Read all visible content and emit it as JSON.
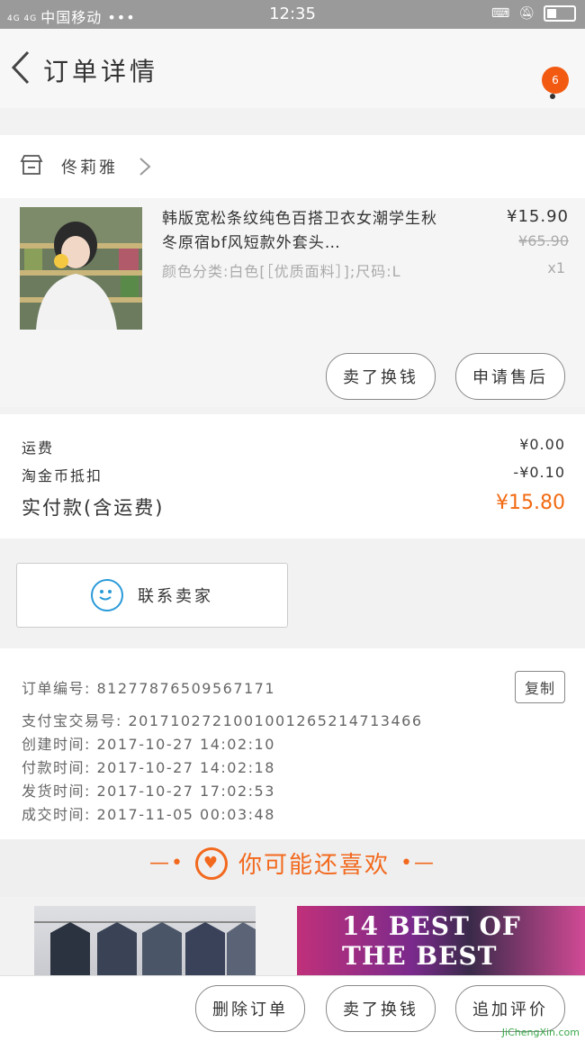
{
  "status_bar": {
    "network": "4G 4G",
    "carrier": "中国移动 •••",
    "time": "12:35"
  },
  "header": {
    "title": "订单详情",
    "badge_count": "6"
  },
  "shop": {
    "name": "佟莉雅"
  },
  "product": {
    "title": "韩版宽松条纹纯色百搭卫衣女潮学生秋冬原宿bf风短款外套头…",
    "spec": "颜色分类:白色[［优质面料］];尺码:L",
    "price": "¥15.90",
    "original_price": "¥65.90",
    "quantity": "x1",
    "buttons": {
      "exchange": "卖了换钱",
      "after_sale": "申请售后"
    }
  },
  "summary": {
    "shipping_label": "运费",
    "shipping_value": "¥0.00",
    "coin_label": "淘金币抵扣",
    "coin_value": "-¥0.10",
    "total_label": "实付款(含运费)",
    "total_value": "¥15.80"
  },
  "contact": {
    "label": "联系卖家"
  },
  "order_info": {
    "order_no": "订单编号: 81277876509567171",
    "alipay_no": "支付宝交易号: 2017102721001001265214713466",
    "created": "创建时间: 2017-10-27 14:02:10",
    "paid": "付款时间: 2017-10-27 14:02:18",
    "shipped": "发货时间: 2017-10-27 17:02:53",
    "completed": "成交时间: 2017-11-05 00:03:48",
    "copy_label": "复制"
  },
  "recommend": {
    "title": "你可能还喜欢",
    "item2_text": "14 BEST OF THE BEST"
  },
  "bottom_bar": {
    "delete_label": "删除订单",
    "exchange_label": "卖了换钱",
    "review_label": "追加评价"
  },
  "watermark": {
    "text": "JiChengXin.com"
  },
  "colors": {
    "accent": "#f2691e",
    "badge": "#f25a12",
    "contact_icon": "#2a9ad8"
  }
}
